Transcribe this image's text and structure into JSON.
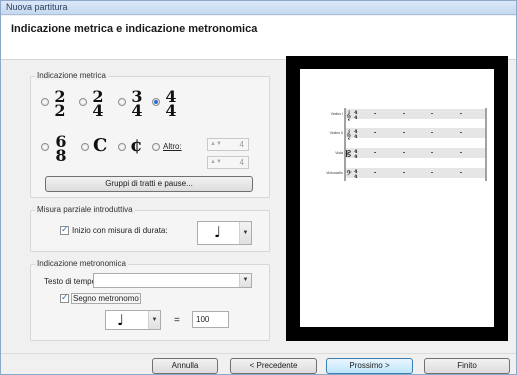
{
  "window": {
    "title": "Nuova partitura"
  },
  "page": {
    "title": "Indicazione metrica e indicazione metronomica"
  },
  "time_signature": {
    "group_label": "Indicazione metrica",
    "options": [
      {
        "top": "2",
        "bottom": "2"
      },
      {
        "top": "2",
        "bottom": "4"
      },
      {
        "top": "3",
        "bottom": "4"
      },
      {
        "top": "4",
        "bottom": "4"
      },
      {
        "top": "6",
        "bottom": "8"
      }
    ],
    "common_time_symbol": "C",
    "cut_time_symbol": "¢",
    "other_label": "Altro:",
    "other_top": "4",
    "other_bottom": "4",
    "selected_index": 3,
    "beam_button": "Gruppi di tratti e pause..."
  },
  "pickup": {
    "group_label": "Misura parziale introduttiva",
    "checkbox_label": "Inizio con misura di durata:",
    "checked": true,
    "note_glyph": "♩"
  },
  "metronome": {
    "group_label": "Indicazione metronomica",
    "tempo_text_label": "Testo di tempo:",
    "tempo_text_value": "",
    "show_metronome_label": "Segno metronomo",
    "show_metronome_checked": true,
    "note_glyph": "♩",
    "equals": "=",
    "bpm": "100"
  },
  "preview": {
    "instruments": [
      "Violino I",
      "Violino II",
      "Viola",
      "Violoncello"
    ]
  },
  "buttons": {
    "cancel": "Annulla",
    "back": "< Precedente",
    "next": "Prossimo >",
    "finish": "Finito"
  },
  "icons": {
    "dropdown": "chevron-down-icon",
    "spinner": "spinner-icon"
  }
}
